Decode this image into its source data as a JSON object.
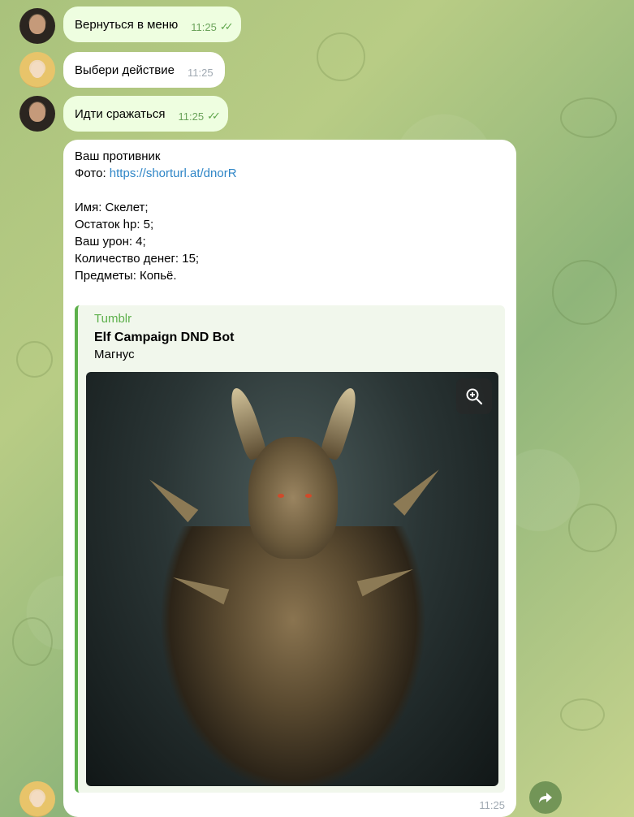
{
  "messages": [
    {
      "text": "Вернуться в меню",
      "time": "11:25"
    },
    {
      "text": "Выбери действие",
      "time": "11:25"
    },
    {
      "text": "Идти сражаться",
      "time": "11:25"
    }
  ],
  "bot_card": {
    "lines": [
      "Ваш противник",
      "Фото: ",
      "",
      "Имя: Скелет;",
      "Остаток hp: 5;",
      "Ваш урон: 4;",
      "Количество денег: 15;",
      "Предметы: Копьё."
    ],
    "photo_link": "https://shorturl.at/dnorR",
    "preview": {
      "site": "Tumblr",
      "title": "Elf Campaign DND Bot",
      "description": "Магнус"
    },
    "time": "11:25"
  },
  "icons": {
    "read_checks": "double-check-icon",
    "zoom": "zoom-in-icon",
    "share": "share-icon"
  },
  "colors": {
    "outgoing_bubble": "#eefee0",
    "incoming_bubble": "#ffffff",
    "link": "#2f86c7",
    "accent_green": "#5db04b"
  }
}
